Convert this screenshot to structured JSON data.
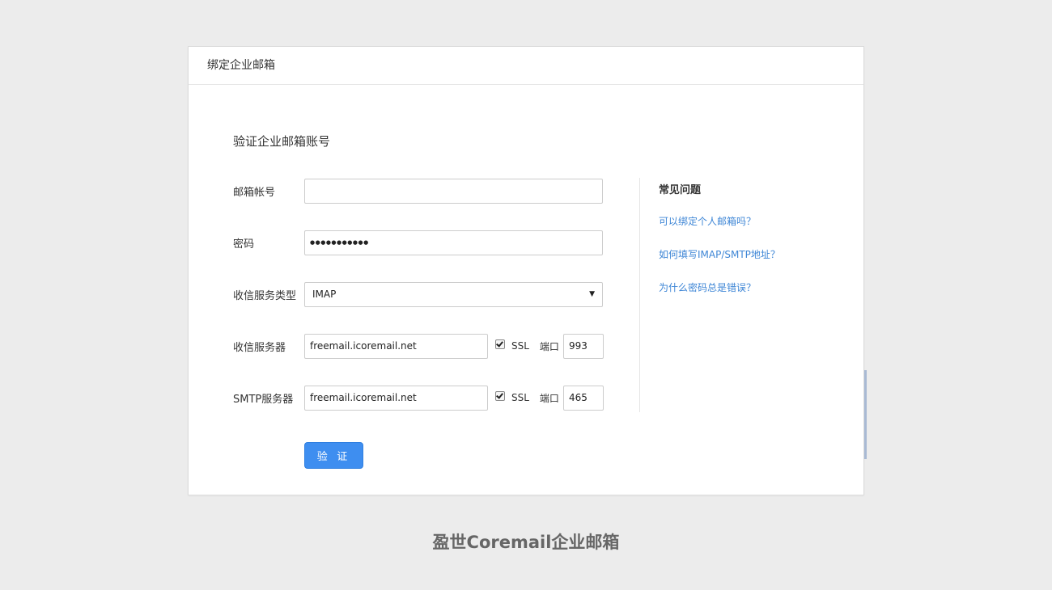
{
  "card": {
    "header_title": "绑定企业邮箱",
    "section_title": "验证企业邮箱账号"
  },
  "form": {
    "email": {
      "label": "邮箱帐号",
      "value": ""
    },
    "password": {
      "label": "密码",
      "value": "●●●●●●●●●●●"
    },
    "protocol": {
      "label": "收信服务类型",
      "value": "IMAP"
    },
    "incoming": {
      "label": "收信服务器",
      "value": "freemail.icoremail.net",
      "ssl_label": "SSL",
      "ssl_checked": true,
      "port_label": "端口",
      "port": "993"
    },
    "smtp": {
      "label": "SMTP服务器",
      "value": "freemail.icoremail.net",
      "ssl_label": "SSL",
      "ssl_checked": true,
      "port_label": "端口",
      "port": "465"
    },
    "submit_label": "验 证"
  },
  "faq": {
    "title": "常见问题",
    "links": [
      "可以绑定个人邮箱吗？",
      "如何填写IMAP/SMTP地址？",
      "为什么密码总是错误？"
    ]
  },
  "brand": "盈世Coremail企业邮箱",
  "colors": {
    "accent": "#3e8ef0",
    "link": "#3e86d6",
    "background": "#ececec"
  }
}
